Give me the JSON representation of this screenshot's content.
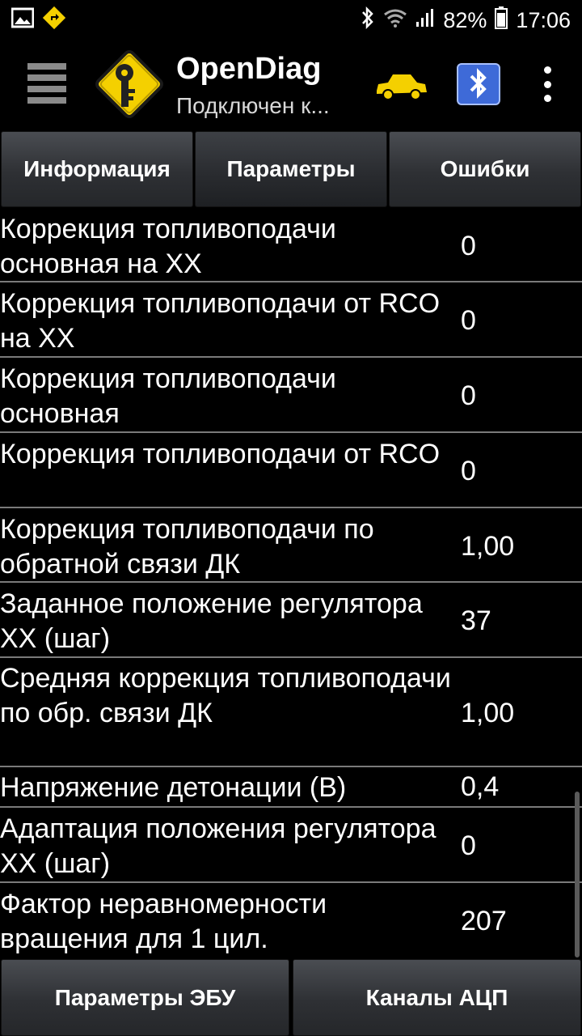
{
  "status_bar": {
    "battery": "82%",
    "time": "17:06",
    "icons": [
      "image-icon",
      "navigation-icon",
      "bluetooth-icon",
      "wifi-icon",
      "signal-icon",
      "battery-icon"
    ]
  },
  "app_bar": {
    "title": "OpenDiag",
    "subtitle": "Подключен к...",
    "icons": [
      "menu-icon",
      "key-logo-icon",
      "car-icon",
      "bluetooth-elm327-icon",
      "overflow-menu-icon"
    ]
  },
  "tabs": [
    {
      "label": "Информация"
    },
    {
      "label": "Параметры"
    },
    {
      "label": "Ошибки"
    }
  ],
  "parameters": [
    {
      "name": "Коррекция топливоподачи основная на ХХ",
      "value": "0"
    },
    {
      "name": "Коррекция топливоподачи от RCO на ХХ",
      "value": "0"
    },
    {
      "name": "Коррекция топливоподачи основная",
      "value": "0"
    },
    {
      "name": "Коррекция топливоподачи от RCO",
      "value": "0"
    },
    {
      "name": "Коррекция топливоподачи по обратной связи ДК",
      "value": "1,00"
    },
    {
      "name": "Заданное положение регулятора ХХ (шаг)",
      "value": "37"
    },
    {
      "name": "Средняя коррекция топливоподачи по обр. связи ДК",
      "value": "1,00"
    },
    {
      "name": "Напряжение детонации (В)",
      "value": "0,4"
    },
    {
      "name": "Адаптация положения регулятора ХХ (шаг)",
      "value": "0"
    },
    {
      "name": "Фактор неравномерности вращения для 1 цил.",
      "value": "207"
    }
  ],
  "bottom_buttons": [
    {
      "label": "Параметры ЭБУ"
    },
    {
      "label": "Каналы АЦП"
    }
  ],
  "colors": {
    "background": "#000000",
    "tab_gradient_top": "#4a4d52",
    "divider": "#7a7a7a",
    "logo_yellow": "#f4d000",
    "bluetooth_blue": "#3e6ad8"
  }
}
